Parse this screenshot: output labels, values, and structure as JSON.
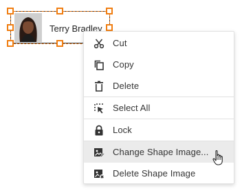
{
  "diagram": {
    "shape_label": "Terry Bradley",
    "selection_color": "#f07d10"
  },
  "context_menu": {
    "items": [
      {
        "label": "Cut",
        "icon": "scissors-icon"
      },
      {
        "label": "Copy",
        "icon": "copy-icon"
      },
      {
        "label": "Delete",
        "icon": "trash-icon"
      },
      {
        "label": "Select All",
        "icon": "select-all-icon"
      },
      {
        "label": "Lock",
        "icon": "lock-icon"
      },
      {
        "label": "Change Shape Image...",
        "icon": "change-image-icon",
        "hovered": true
      },
      {
        "label": "Delete Shape Image",
        "icon": "delete-image-icon"
      }
    ]
  },
  "cursor": {
    "icon": "hand-pointer-cursor"
  }
}
